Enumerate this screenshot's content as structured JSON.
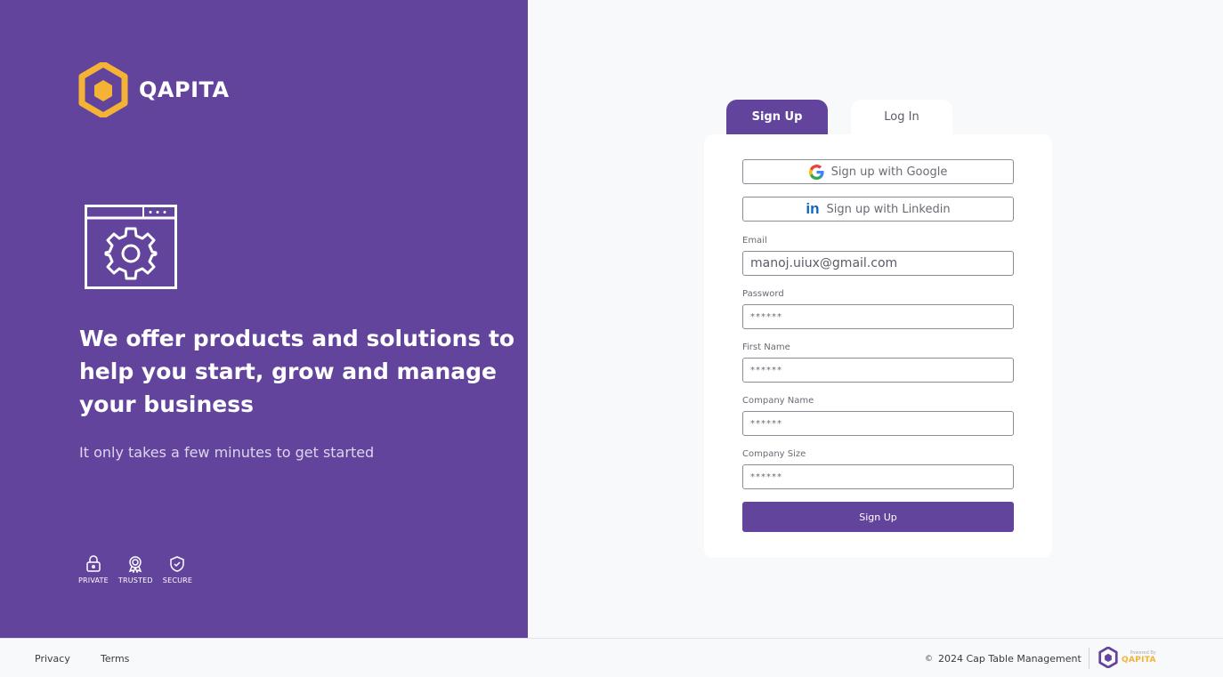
{
  "brand": {
    "name": "QAPITA",
    "logo_color": "#f5b335"
  },
  "colors": {
    "primary": "#63449c",
    "accent": "#f5b335",
    "background": "#f8f9fb"
  },
  "left_panel": {
    "hero_icon": "settings-window-icon",
    "headline": "We offer products and solutions to help you start, grow and manage your business",
    "subline": "It only takes a few minutes to get started",
    "badges": [
      {
        "label": "PRIVATE",
        "icon": "lock-icon"
      },
      {
        "label": "TRUSTED",
        "icon": "award-icon"
      },
      {
        "label": "SECURE",
        "icon": "shield-check-icon"
      }
    ]
  },
  "tabs": [
    {
      "label": "Sign Up",
      "active": true
    },
    {
      "label": "Log In",
      "active": false
    }
  ],
  "form": {
    "google_button": "Sign up with Google",
    "linkedin_button": "Sign up with Linkedin",
    "fields": [
      {
        "label": "Email",
        "value": "manoj.uiux@gmail.com"
      },
      {
        "label": "Password",
        "value": "******"
      },
      {
        "label": "First Name",
        "value": "******"
      },
      {
        "label": "Company Name",
        "value": "******"
      },
      {
        "label": "Company Size",
        "value": "******"
      }
    ],
    "submit_label": "Sign Up"
  },
  "footer": {
    "links": [
      "Privacy",
      "Terms"
    ],
    "copyright_symbol": "©",
    "copyright": "2024 Cap Table Management",
    "powered_by": "Powered By",
    "powered_name": "QAPITA"
  }
}
